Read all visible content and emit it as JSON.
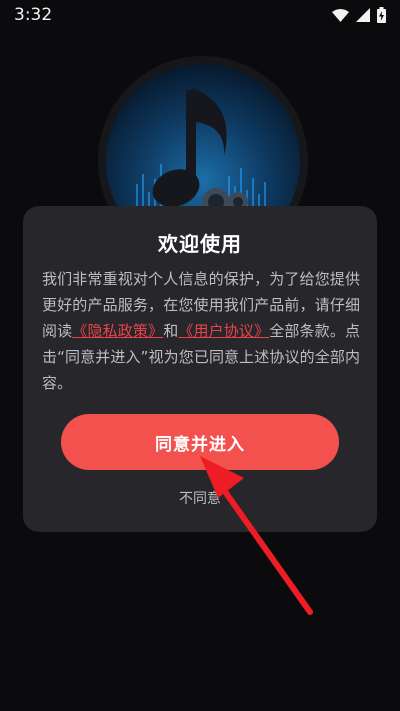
{
  "status_bar": {
    "time": "3:32",
    "icons": [
      "wifi-icon",
      "signal-icon",
      "battery-charging-icon"
    ]
  },
  "dialog": {
    "title": "欢迎使用",
    "body_part1": "我们非常重视对个人信息的保护，为了给您提供更好的产品服务，在您使用我们产品前，请仔细阅读",
    "privacy_link": "《隐私政策》",
    "and": "和",
    "terms_link": "《用户协议》",
    "body_part2": "全部条款。点击“同意并进入”视为您已同意上述协议的全部内容。",
    "agree_label": "同意并进入",
    "disagree_label": "不同意"
  },
  "colors": {
    "agree_button": "#f2514d",
    "link": "#e9434a",
    "dialog_bg": "#26262b",
    "background": "#0b0b0d",
    "arrow": "#ee1c25"
  }
}
